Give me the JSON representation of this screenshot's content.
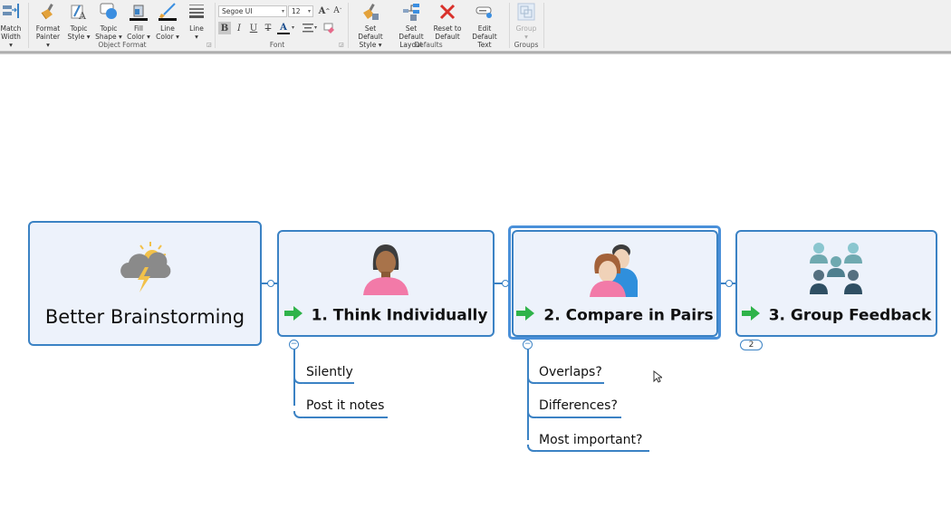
{
  "ribbon": {
    "match_width": {
      "label1": "Match",
      "label2": "Width ▾"
    },
    "object_format": {
      "group_label": "Object Format",
      "buttons": [
        {
          "label1": "Format",
          "label2": "Painter ▾",
          "icon": "format-painter-icon"
        },
        {
          "label1": "Topic",
          "label2": "Style ▾",
          "icon": "topic-style-icon"
        },
        {
          "label1": "Topic",
          "label2": "Shape ▾",
          "icon": "topic-shape-icon"
        },
        {
          "label1": "Fill",
          "label2": "Color ▾",
          "icon": "fill-color-icon"
        },
        {
          "label1": "Line",
          "label2": "Color ▾",
          "icon": "line-color-icon"
        },
        {
          "label1": "Line",
          "label2": "▾",
          "icon": "line-style-icon"
        }
      ]
    },
    "font": {
      "group_label": "Font",
      "font_name": "Segoe UI",
      "font_size": "12",
      "grow_label": "A",
      "shrink_label": "A",
      "bold": "B",
      "italic": "I",
      "underline": "U",
      "strike": "T",
      "font_color": "A"
    },
    "defaults": {
      "group_label": "Defaults",
      "buttons": [
        {
          "label1": "Set Default",
          "label2": "Style ▾",
          "icon": "set-default-style-icon"
        },
        {
          "label1": "Set Default",
          "label2": "Layout",
          "icon": "set-default-layout-icon"
        },
        {
          "label1": "Reset to",
          "label2": "Default",
          "icon": "reset-icon"
        },
        {
          "label1": "Edit Default",
          "label2": "Text",
          "icon": "edit-default-text-icon"
        }
      ]
    },
    "groups": {
      "group_label": "Groups",
      "group_button": {
        "label1": "Group",
        "label2": "▾",
        "disabled": true
      }
    }
  },
  "map": {
    "central": {
      "title": "Better Brainstorming",
      "icon": "storm-cloud-icon"
    },
    "topics": [
      {
        "title": "1. Think Individually",
        "icon": "person-icon",
        "marker": "green-arrow-icon",
        "subtopics": [
          "Silently",
          "Post it notes"
        ],
        "collapse": "−"
      },
      {
        "title": "2. Compare in Pairs",
        "icon": "pair-icon",
        "marker": "green-arrow-icon",
        "selected": true,
        "subtopics": [
          "Overlaps?",
          "Differences?",
          "Most important?"
        ],
        "collapse": "−"
      },
      {
        "title": "3. Group Feedback",
        "icon": "group-icon",
        "marker": "green-arrow-icon",
        "hidden_count": "2"
      }
    ]
  },
  "colors": {
    "accent": "#3b82c4",
    "node_fill": "#edf2fb",
    "marker_green": "#2fb34a"
  }
}
